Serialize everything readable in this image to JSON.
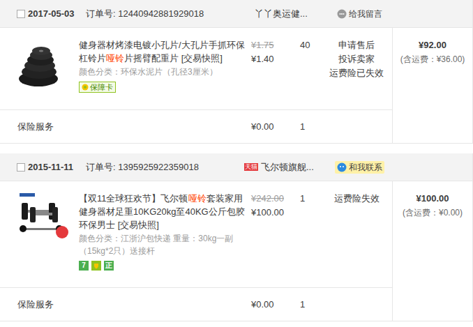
{
  "orders": [
    {
      "selected": false,
      "date": "2017-05-03",
      "order_no_label": "订单号:",
      "order_no": "12440942881929018",
      "shop": "丫丫奥运健...",
      "contact": {
        "label": "给我留言",
        "kind": "message"
      },
      "product": {
        "image": "plates",
        "title_parts": [
          {
            "text": "健身器材烤漆电镀小孔片/大孔片手抓环保杠铃片",
            "highlight": false
          },
          {
            "text": "哑铃",
            "highlight": true
          },
          {
            "text": "片摇臂配重片 ",
            "highlight": false
          }
        ],
        "snapshot": "[交易快照]",
        "attributes": "颜色分类：环保水泥片（孔径3厘米）",
        "badges": [
          {
            "kind": "card",
            "text": "保障卡"
          }
        ],
        "original_price": "¥1.75",
        "price": "¥1.40",
        "qty": "40"
      },
      "actions": [
        "申请售后",
        "投诉卖家",
        "运费险已失效"
      ],
      "total": "¥92.00",
      "shipping": "(含运费：¥36.00)",
      "insurance": {
        "label": "保险服务",
        "price": "¥0.00",
        "qty": "1"
      }
    },
    {
      "selected": false,
      "date": "2015-11-11",
      "order_no_label": "订单号:",
      "order_no": "1395925922359018",
      "shop_badge": "天猫",
      "shop": "飞尔顿旗舰...",
      "contact": {
        "label": "和我联系",
        "kind": "wangwang"
      },
      "product": {
        "image": "dumbbells",
        "title_parts": [
          {
            "text": "【双11全球狂欢节】飞尔顿",
            "highlight": false
          },
          {
            "text": "哑铃",
            "highlight": true
          },
          {
            "text": "套装家用健身器材足重10KG20kg至40KG公斤包胶环保男士 ",
            "highlight": false
          }
        ],
        "snapshot": "[交易快照]",
        "attributes": "颜色分类：江浙沪包快递  重量：30kg一副（15kg*2只）送接杆",
        "badges": [
          {
            "kind": "seven",
            "text": "7"
          },
          {
            "kind": "insured"
          },
          {
            "kind": "genuine",
            "text": "正"
          }
        ],
        "original_price": "¥242.00",
        "price": "¥100.00",
        "qty": "1"
      },
      "actions": [
        "运费险失效"
      ],
      "total": "¥100.00",
      "shipping": "(含运费：¥0.00)",
      "insurance": {
        "label": "保险服务",
        "price": "¥0.00",
        "qty": "1"
      }
    }
  ]
}
